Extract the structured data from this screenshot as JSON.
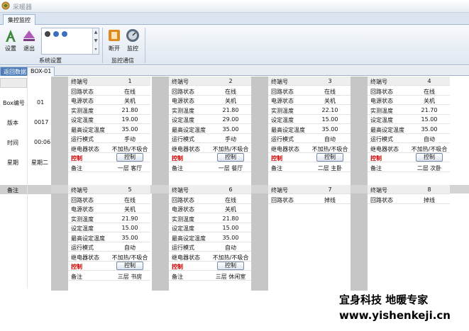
{
  "app": {
    "title": "采暖器"
  },
  "ribbon": {
    "tab_label": "集控监控",
    "settings_label": "设置",
    "exit_label": "退出",
    "group1_label": "系统设置",
    "disconnect_label": "断开",
    "monitor_label": "监控",
    "group2_label": "监控通信"
  },
  "doc_tabs": [
    "返回数据",
    "BOX-01"
  ],
  "left_panel": {
    "rows": [
      {
        "label": "Box编号",
        "value": "01"
      },
      {
        "label": "版本",
        "value": "0017"
      },
      {
        "label": "时间",
        "value": "00:06"
      },
      {
        "label": "星期",
        "value": "星期二"
      }
    ],
    "note_label": "备注"
  },
  "field_labels": {
    "terminal": "终端号",
    "loop": "回路状态",
    "power": "电源状态",
    "actual_temp": "实测温度",
    "set_temp": "设定温度",
    "max_temp": "最高设定温度",
    "mode": "运行模式",
    "relay": "继电器状态",
    "control": "控制",
    "note": "备注"
  },
  "control_button_label": "控制",
  "terminals": [
    {
      "id": "1",
      "loop": "在线",
      "power": "关机",
      "actual_temp": "21.80",
      "set_temp": "19.00",
      "max_temp": "35.00",
      "mode": "手动",
      "relay": "不加热/不吸合",
      "note": "一层  客厅"
    },
    {
      "id": "2",
      "loop": "在线",
      "power": "关机",
      "actual_temp": "21.80",
      "set_temp": "29.00",
      "max_temp": "35.00",
      "mode": "手动",
      "relay": "不加热/不吸合",
      "note": "一层  餐厅"
    },
    {
      "id": "3",
      "loop": "在线",
      "power": "关机",
      "actual_temp": "22.10",
      "set_temp": "15.00",
      "max_temp": "35.00",
      "mode": "自动",
      "relay": "不加热/不吸合",
      "note": "二层  主卧"
    },
    {
      "id": "4",
      "loop": "在线",
      "power": "关机",
      "actual_temp": "21.70",
      "set_temp": "15.00",
      "max_temp": "35.00",
      "mode": "自动",
      "relay": "不加热/不吸合",
      "note": "二层  次卧"
    },
    {
      "id": "5",
      "loop": "在线",
      "power": "关机",
      "actual_temp": "21.90",
      "set_temp": "15.00",
      "max_temp": "35.00",
      "mode": "自动",
      "relay": "不加热/不吸合",
      "note": "三层  书房"
    },
    {
      "id": "6",
      "loop": "在线",
      "power": "关机",
      "actual_temp": "21.80",
      "set_temp": "15.00",
      "max_temp": "35.00",
      "mode": "自动",
      "relay": "不加热/不吸合",
      "note": "三层  休闲室"
    },
    {
      "id": "7",
      "loop": "掉线"
    },
    {
      "id": "8",
      "loop": "掉线"
    }
  ],
  "watermark": {
    "line1": "宜身科技   地暖专家",
    "line2": "www.yishenkeji.cn"
  },
  "colors": {
    "control_label": "#cc0000",
    "separator_gray": "#c6c6c6",
    "ribbon_bg": "#dfe7f1"
  }
}
